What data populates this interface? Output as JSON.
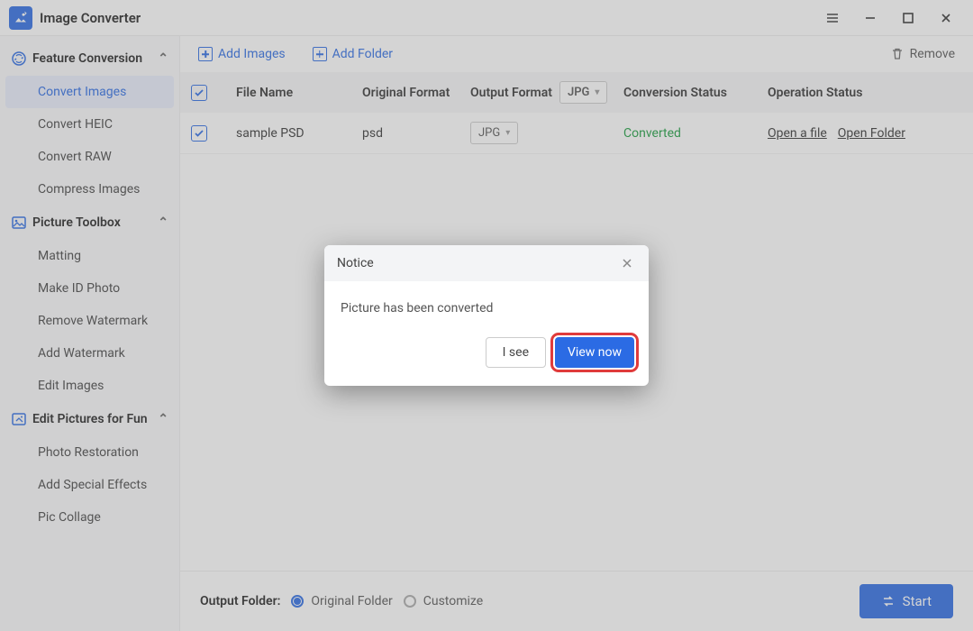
{
  "app": {
    "title": "Image Converter"
  },
  "window_controls": {
    "menu": "≡",
    "min": "—",
    "max": "▢",
    "close": "✕"
  },
  "sidebar": {
    "groups": [
      {
        "label": "Feature Conversion",
        "items": [
          {
            "label": "Convert Images",
            "selected": true
          },
          {
            "label": "Convert HEIC"
          },
          {
            "label": "Convert RAW"
          },
          {
            "label": "Compress Images"
          }
        ]
      },
      {
        "label": "Picture Toolbox",
        "items": [
          {
            "label": "Matting"
          },
          {
            "label": "Make ID Photo"
          },
          {
            "label": "Remove Watermark"
          },
          {
            "label": "Add Watermark"
          },
          {
            "label": "Edit Images"
          }
        ]
      },
      {
        "label": "Edit Pictures for Fun",
        "items": [
          {
            "label": "Photo Restoration"
          },
          {
            "label": "Add Special Effects"
          },
          {
            "label": "Pic Collage"
          }
        ]
      }
    ]
  },
  "toolbar": {
    "add_images": "Add Images",
    "add_folder": "Add Folder",
    "remove": "Remove"
  },
  "table": {
    "headers": {
      "file_name": "File Name",
      "original_format": "Original Format",
      "output_format": "Output Format",
      "output_format_value": "JPG",
      "conversion_status": "Conversion Status",
      "operation_status": "Operation Status"
    },
    "rows": [
      {
        "file_name": "sample PSD",
        "original_format": "psd",
        "output_format": "JPG",
        "conversion_status": "Converted",
        "open_file": "Open a file",
        "open_folder": "Open Folder"
      }
    ]
  },
  "bottom": {
    "label": "Output Folder:",
    "original": "Original Folder",
    "customize": "Customize",
    "start": "Start"
  },
  "dialog": {
    "title": "Notice",
    "message": "Picture has been converted",
    "i_see": "I see",
    "view_now": "View now"
  }
}
